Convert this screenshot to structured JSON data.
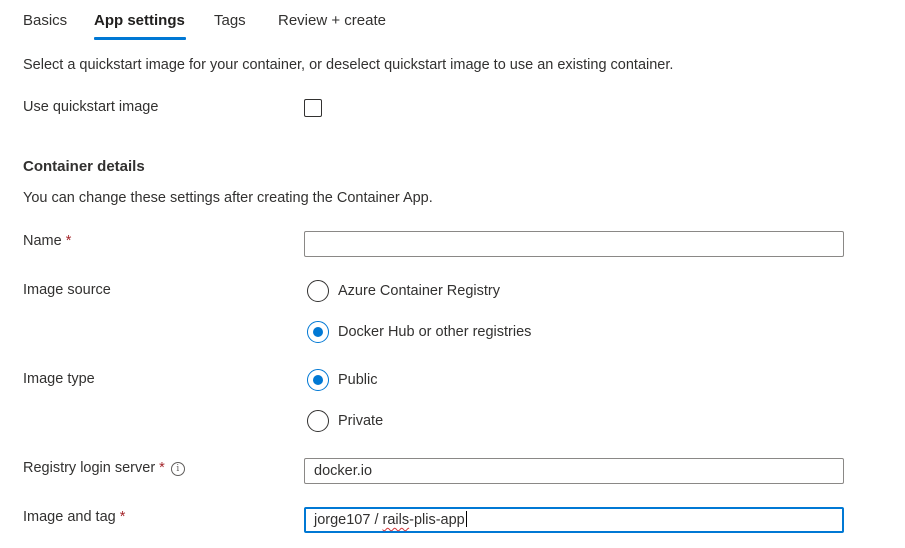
{
  "tabs": [
    {
      "label": "Basics",
      "active": false
    },
    {
      "label": "App settings",
      "active": true
    },
    {
      "label": "Tags",
      "active": false
    },
    {
      "label": "Review + create",
      "active": false
    }
  ],
  "intro_text": "Select a quickstart image for your container, or deselect quickstart image to use an existing container.",
  "quickstart": {
    "label": "Use quickstart image",
    "checked": false
  },
  "container_details": {
    "title": "Container details",
    "description": "You can change these settings after creating the Container App.",
    "name": {
      "label": "Name",
      "required_mark": "*",
      "value": ""
    },
    "image_source": {
      "label": "Image source",
      "options": [
        {
          "label": "Azure Container Registry",
          "selected": false
        },
        {
          "label": "Docker Hub or other registries",
          "selected": true
        }
      ]
    },
    "image_type": {
      "label": "Image type",
      "options": [
        {
          "label": "Public",
          "selected": true
        },
        {
          "label": "Private",
          "selected": false
        }
      ]
    },
    "registry_login_server": {
      "label": "Registry login server",
      "required_mark": "*",
      "info_glyph": "i",
      "value": "docker.io"
    },
    "image_and_tag": {
      "label": "Image and tag",
      "required_mark": "*",
      "value_prefix": "jorge107 / ",
      "value_flagged": "rails",
      "value_suffix": "-plis-app"
    }
  },
  "colors": {
    "accent": "#0078d4",
    "required": "#a4262c",
    "spellcheck": "#d13438"
  }
}
